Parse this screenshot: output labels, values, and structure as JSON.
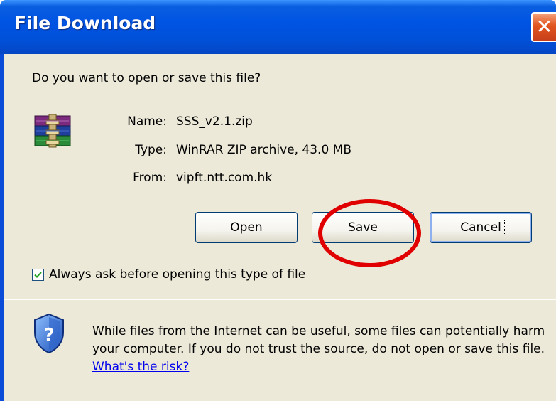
{
  "window": {
    "title": "File Download",
    "close_glyph": "✕"
  },
  "dialog": {
    "prompt": "Do you want to open or save this file?",
    "file_icon": "winrar-archive-icon",
    "fields": [
      {
        "label": "Name:",
        "value": "SSS_v2.1.zip"
      },
      {
        "label": "Type:",
        "value": "WinRAR ZIP archive, 43.0 MB"
      },
      {
        "label": "From:",
        "value": "vipft.ntt.com.hk"
      }
    ],
    "buttons": {
      "open": {
        "label": "Open"
      },
      "save": {
        "label": "Save"
      },
      "cancel": {
        "label": "Cancel"
      }
    },
    "checkbox": {
      "label": "Always ask before opening this type of file",
      "checked": true
    },
    "warning": {
      "icon": "security-shield-icon",
      "text": "While files from the Internet can be useful, some files can potentially harm your computer. If you do not trust the source, do not open or save this file.",
      "link": "What's the risk?"
    }
  },
  "annotation": {
    "color": "#e00000",
    "target": "save-button"
  },
  "colors": {
    "titlebar": "#0054e3",
    "dialog_bg": "#ece9d8",
    "close_button": "#e1551f",
    "link": "#0000ee"
  }
}
